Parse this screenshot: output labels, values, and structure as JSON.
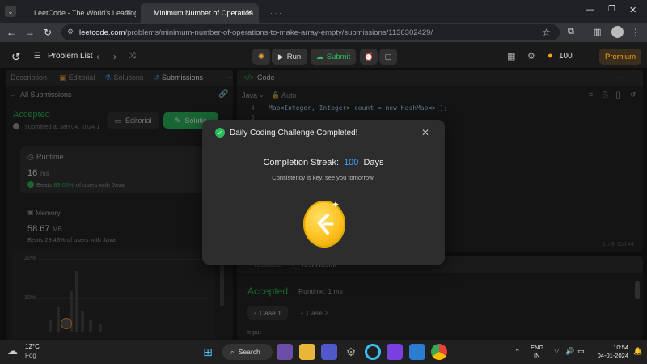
{
  "browser": {
    "tabs": [
      {
        "title": "LeetCode - The World's Leading"
      },
      {
        "title": "Minimum Number of Operation"
      },
      {
        "title": "· · ·"
      }
    ],
    "url_host": "leetcode.com",
    "url_path": "/problems/minimum-number-of-operations-to-make-array-empty/submissions/1136302429/"
  },
  "header": {
    "problem_list": "Problem List",
    "run": "Run",
    "submit": "Submit",
    "coins": "100",
    "premium": "Premium"
  },
  "left_panel": {
    "tabs": [
      "Description",
      "Editorial",
      "Solutions",
      "Submissions"
    ],
    "all_submissions": "All Submissions",
    "status": "Accepted",
    "submitted_at": "submitted at Jan 04, 2024 1",
    "editorial_btn": "Editorial",
    "solution_btn": "Solutio",
    "runtime_label": "Runtime",
    "runtime_value": "16",
    "runtime_unit": "ms",
    "runtime_beats_prefix": "Beats",
    "runtime_beats": "89.06%",
    "runtime_beats_suffix": "of users with Java",
    "memory_label": "Memory",
    "memory_value": "58.67",
    "memory_unit": "MB",
    "memory_beats": "Beats 29.43% of users with Java",
    "chart_tick_20": "20%",
    "chart_tick_10": "10%"
  },
  "code_panel": {
    "title": "Code",
    "lang": "Java",
    "mode": "Auto",
    "line_numbers": [
      "4",
      "5"
    ],
    "line4": "Map<Integer, Integer> count = new HashMap<>();",
    "cursor_pos": "Ln 9, Col 44"
  },
  "result_panel": {
    "tabs": [
      "Testcase",
      "Test Result"
    ],
    "status": "Accepted",
    "runtime": "Runtime: 1 ms",
    "case1": "Case 1",
    "case2": "Case 2",
    "input_label": "Input"
  },
  "modal": {
    "title": "Daily Coding Challenge Completed!",
    "streak_label": "Completion Streak:",
    "streak_value": "100",
    "streak_unit": "Days",
    "subtitle": "Consistency is key, see you tomorrow!"
  },
  "taskbar": {
    "temp": "12°C",
    "weather": "Fog",
    "search": "Search",
    "lang1": "ENG",
    "lang2": "IN",
    "time": "10:54",
    "date": "04-01-2024"
  },
  "colors": {
    "accepted": "#2cbb5d",
    "streak_blue": "#3ea2ff",
    "coin": "#ffc01e"
  }
}
